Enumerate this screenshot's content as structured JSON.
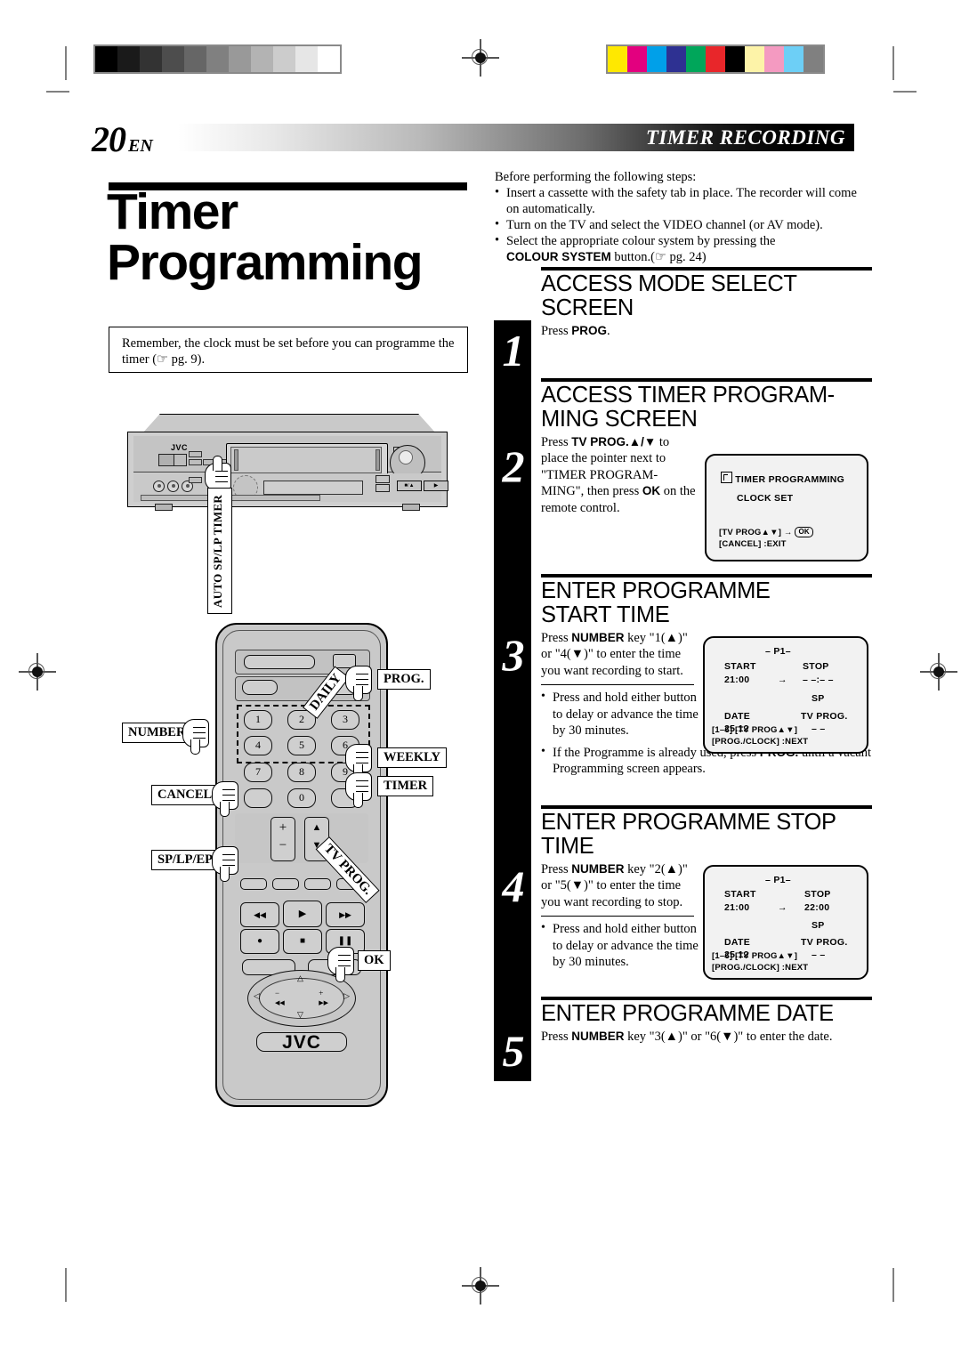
{
  "page": {
    "number": "20",
    "lang": "EN",
    "section_title": "TIMER RECORDING"
  },
  "left": {
    "title_line1": "Timer",
    "title_line2": "Programming",
    "note": "Remember, the clock must be set before you can programme the timer (☞ pg. 9).",
    "vcr_label": "AUTO SP/LP TIMER",
    "vcr_brand": "JVC",
    "remote_brand": "JVC",
    "remote_labels": {
      "prog": "PROG.",
      "number": "NUMBER",
      "daily": "DAILY",
      "weekly": "WEEKLY",
      "timer": "TIMER",
      "cancel": "CANCEL",
      "splpep": "SP/LP/EP",
      "tvprog": "TV PROG.",
      "ok": "OK"
    },
    "keypad": [
      "1",
      "2",
      "3",
      "4",
      "5",
      "6",
      "7",
      "8",
      "9",
      "0"
    ]
  },
  "intro": {
    "lead": "Before performing the following steps:",
    "bullets": [
      "Insert a cassette with the safety tab in place. The recorder will come on automatically.",
      "Turn on the TV and select the VIDEO channel (or AV mode).",
      "Select the appropriate colour system by pressing the COLOUR SYSTEM button.(☞ pg. 24)"
    ]
  },
  "steps": [
    {
      "num": "1",
      "heading": "ACCESS MODE SELECT SCREEN",
      "body": "Press PROG.",
      "body_pre": "Press ",
      "body_bold": "PROG",
      "body_post": "."
    },
    {
      "num": "2",
      "heading": "ACCESS TIMER PROGRAM- MING SCREEN",
      "body": "Press TV PROG.▲/▼ to place the pointer next to \"TIMER PROGRAM-MING\", then press OK on the remote control."
    },
    {
      "num": "3",
      "heading": "ENTER PROGRAMME START TIME",
      "body": "Press NUMBER key \"1(▲)\" or \"4(▼)\" to enter the time you want recording to start.",
      "bullets": [
        "Press and hold either button to delay or advance the time by 30 minutes.",
        "If the Programme is already used, press PROG. until a vacant Programming screen appears."
      ]
    },
    {
      "num": "4",
      "heading": "ENTER PROGRAMME STOP TIME",
      "body": "Press NUMBER key \"2(▲)\" or \"5(▼)\" to enter the time you want recording to stop.",
      "bullets": [
        "Press and hold either button to delay or advance the time by 30 minutes."
      ]
    },
    {
      "num": "5",
      "heading": "ENTER PROGRAMME DATE",
      "body": "Press NUMBER key \"3(▲)\" or \"6(▼)\" to enter the date."
    }
  ],
  "osd_menu": {
    "item1": "TIMER PROGRAMMING",
    "item2": "CLOCK SET",
    "hint1": "[TV PROG▲▼] →",
    "hint1_key": "OK",
    "hint2": "[CANCEL] :EXIT"
  },
  "osd_program_start": {
    "program": "– P1–",
    "start_label": "START",
    "start_value": "21:00",
    "arrow": "→",
    "stop_label": "STOP",
    "stop_value": "– –:– –",
    "speed": "SP",
    "date_label": "DATE",
    "date_value": "25.12",
    "tvprog_label": "TV PROG.",
    "tvprog_value": "– –",
    "hint1": "[1–6] [TV PROG▲▼]",
    "hint2": "[PROG./CLOCK] :NEXT"
  },
  "osd_program_stop": {
    "program": "– P1–",
    "start_label": "START",
    "start_value": "21:00",
    "arrow": "→",
    "stop_label": "STOP",
    "stop_value": "22:00",
    "speed": "SP",
    "date_label": "DATE",
    "date_value": "25.12",
    "tvprog_label": "TV PROG.",
    "tvprog_value": "– –",
    "hint1": "[1–6] [TV PROG▲▼]",
    "hint2": "[PROG./CLOCK] :NEXT"
  },
  "calibration": {
    "grayscale": [
      "#000000",
      "#1a1a1a",
      "#333333",
      "#4d4d4d",
      "#666666",
      "#808080",
      "#999999",
      "#b3b3b3",
      "#cccccc",
      "#e6e6e6",
      "#ffffff"
    ],
    "colours": [
      "#ffe800",
      "#e3007f",
      "#00a0e9",
      "#2e3192",
      "#00a65a",
      "#e8262a",
      "#000000",
      "#fdf3a8",
      "#f49ac1",
      "#6dcff6",
      "#808080"
    ]
  }
}
